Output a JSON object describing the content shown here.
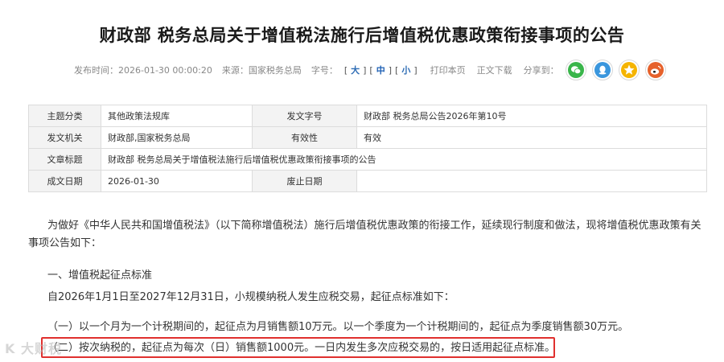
{
  "article": {
    "title": "财政部 税务总局关于增值税法施行后增值税优惠政策衔接事项的公告"
  },
  "meta": {
    "publish_time": "发布时间：2026-01-30 00:00:20",
    "source": "来源：国家税务总局",
    "font_size_label": "字号：",
    "bracket_open": "[",
    "bracket_close": "]",
    "size_large": "大",
    "size_medium": "中",
    "size_small": "小",
    "print": "打印本页",
    "download": "正文下载",
    "share_label": "分享到：",
    "share_icons": [
      "wechat-icon",
      "qq-icon",
      "qzone-icon",
      "weibo-icon"
    ],
    "share_colors": [
      "#39b54a",
      "#3a96dd",
      "#f5b400",
      "#e6612b"
    ]
  },
  "info_table": {
    "topic_label": "主题分类",
    "topic_value": "其他政策法规库",
    "doc_no_label": "发文字号",
    "doc_no_value": "财政部 税务总局公告2026年第10号",
    "issuer_label": "发文机关",
    "issuer_value": "财政部,国家税务总局",
    "validity_label": "有效性",
    "validity_value": "有效",
    "doc_title_label": "文章标题",
    "doc_title_value": "财政部 税务总局关于增值税法施行后增值税优惠政策衔接事项的公告",
    "date_label": "成文日期",
    "date_value": "2026-01-30",
    "repeal_label": "废止日期",
    "repeal_value": ""
  },
  "body": {
    "intro": "为做好《中华人民共和国增值税法》（以下简称增值税法）施行后增值税优惠政策的衔接工作，延续现行制度和做法，现将增值税优惠政策有关事项公告如下：",
    "heading1": "一、增值税起征点标准",
    "line1": "自2026年1月1日至2027年12月31日，小规模纳税人发生应税交易，起征点标准如下：",
    "line2": "（一）以一个月为一个计税期间的，起征点为月销售额10万元。以一个季度为一个计税期间的，起征点为季度销售额30万元。",
    "line3": "（二）按次纳税的，起征点为每次（日）销售额1000元。一日内发生多次应税交易的，按日适用起征点标准。"
  },
  "watermark": "K 大财税",
  "highlight_color": "#e0302e"
}
